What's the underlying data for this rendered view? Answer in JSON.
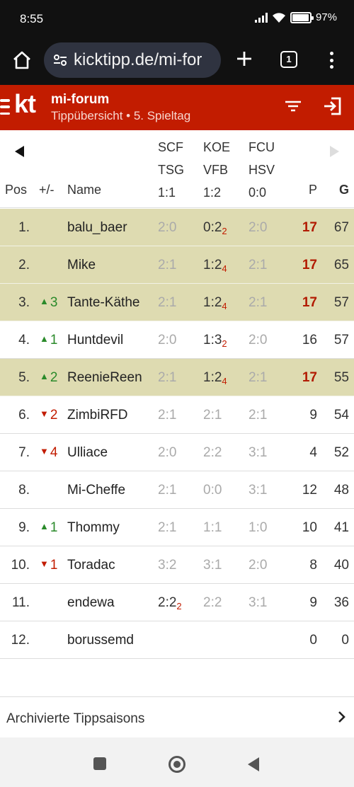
{
  "statusbar": {
    "time": "8:55",
    "battery": "97",
    "battery_level": 0.97
  },
  "browser": {
    "url": "kicktipp.de/mi-for",
    "tab_count": "1"
  },
  "header": {
    "logo": "kt",
    "group_name": "mi-forum",
    "subtitle": "Tippübersicht • 5. Spieltag"
  },
  "table": {
    "col_pos": "Pos",
    "col_change": "+/-",
    "col_name": "Name",
    "col_points": "P",
    "col_total": "G",
    "matches": [
      {
        "home": "SCF",
        "away": "TSG",
        "result": "1:1"
      },
      {
        "home": "KOE",
        "away": "VFB",
        "result": "1:2"
      },
      {
        "home": "FCU",
        "away": "HSV",
        "result": "0:0"
      }
    ],
    "rows": [
      {
        "pos": "1.",
        "arrow": "",
        "change": "",
        "name": "balu_baer",
        "tips": [
          {
            "t": "2:0",
            "p": ""
          },
          {
            "t": "0:2",
            "p": "2"
          },
          {
            "t": "2:0",
            "p": ""
          }
        ],
        "points": "17",
        "total": "67",
        "highlight": true
      },
      {
        "pos": "2.",
        "arrow": "",
        "change": "",
        "name": "Mike",
        "tips": [
          {
            "t": "2:1",
            "p": ""
          },
          {
            "t": "1:2",
            "p": "4"
          },
          {
            "t": "2:1",
            "p": ""
          }
        ],
        "points": "17",
        "total": "65",
        "highlight": true
      },
      {
        "pos": "3.",
        "arrow": "up",
        "change": "3",
        "name": "Tante-Käthe",
        "tips": [
          {
            "t": "2:1",
            "p": ""
          },
          {
            "t": "1:2",
            "p": "4"
          },
          {
            "t": "2:1",
            "p": ""
          }
        ],
        "points": "17",
        "total": "57",
        "highlight": true
      },
      {
        "pos": "4.",
        "arrow": "up",
        "change": "1",
        "name": "Huntdevil",
        "tips": [
          {
            "t": "2:0",
            "p": ""
          },
          {
            "t": "1:3",
            "p": "2"
          },
          {
            "t": "2:0",
            "p": ""
          }
        ],
        "points": "16",
        "total": "57",
        "highlight": false
      },
      {
        "pos": "5.",
        "arrow": "up",
        "change": "2",
        "name": "ReenieReen",
        "tips": [
          {
            "t": "2:1",
            "p": ""
          },
          {
            "t": "1:2",
            "p": "4"
          },
          {
            "t": "2:1",
            "p": ""
          }
        ],
        "points": "17",
        "total": "55",
        "highlight": true
      },
      {
        "pos": "6.",
        "arrow": "down",
        "change": "2",
        "name": "ZimbiRFD",
        "tips": [
          {
            "t": "2:1",
            "p": ""
          },
          {
            "t": "2:1",
            "p": ""
          },
          {
            "t": "2:1",
            "p": ""
          }
        ],
        "points": "9",
        "total": "54",
        "highlight": false
      },
      {
        "pos": "7.",
        "arrow": "down",
        "change": "4",
        "name": "Ulliace",
        "tips": [
          {
            "t": "2:0",
            "p": ""
          },
          {
            "t": "2:2",
            "p": ""
          },
          {
            "t": "3:1",
            "p": ""
          }
        ],
        "points": "4",
        "total": "52",
        "highlight": false
      },
      {
        "pos": "8.",
        "arrow": "",
        "change": "",
        "name": "Mi-Cheffe",
        "tips": [
          {
            "t": "2:1",
            "p": ""
          },
          {
            "t": "0:0",
            "p": ""
          },
          {
            "t": "3:1",
            "p": ""
          }
        ],
        "points": "12",
        "total": "48",
        "highlight": false
      },
      {
        "pos": "9.",
        "arrow": "up",
        "change": "1",
        "name": "Thommy",
        "tips": [
          {
            "t": "2:1",
            "p": ""
          },
          {
            "t": "1:1",
            "p": ""
          },
          {
            "t": "1:0",
            "p": ""
          }
        ],
        "points": "10",
        "total": "41",
        "highlight": false
      },
      {
        "pos": "10.",
        "arrow": "down",
        "change": "1",
        "name": "Toradac",
        "tips": [
          {
            "t": "3:2",
            "p": ""
          },
          {
            "t": "3:1",
            "p": ""
          },
          {
            "t": "2:0",
            "p": ""
          }
        ],
        "points": "8",
        "total": "40",
        "highlight": false
      },
      {
        "pos": "11.",
        "arrow": "",
        "change": "",
        "name": "endewa",
        "tips": [
          {
            "t": "2:2",
            "p": "2"
          },
          {
            "t": "2:2",
            "p": ""
          },
          {
            "t": "3:1",
            "p": ""
          }
        ],
        "points": "9",
        "total": "36",
        "highlight": false
      },
      {
        "pos": "12.",
        "arrow": "",
        "change": "",
        "name": "borussemd",
        "tips": [
          {
            "t": "",
            "p": ""
          },
          {
            "t": "",
            "p": ""
          },
          {
            "t": "",
            "p": ""
          }
        ],
        "points": "0",
        "total": "0",
        "highlight": false
      }
    ]
  },
  "footer": {
    "archive_label": "Archivierte Tippsaisons"
  },
  "colors": {
    "brand_red": "#c21c00",
    "highlight_row": "#dedbb1",
    "up": "#2a8a2a",
    "down": "#c21c00"
  }
}
